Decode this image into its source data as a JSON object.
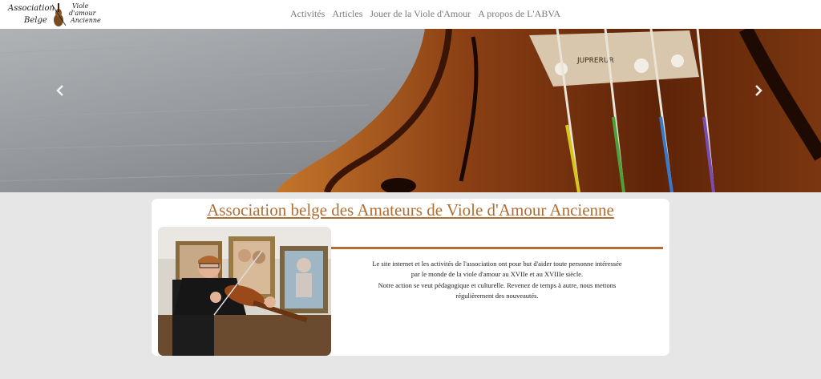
{
  "logo": {
    "line1": "Association",
    "line2": "Belge",
    "line3a": "Viole",
    "line3b": "d'amour",
    "line3c": "Ancienne"
  },
  "nav": {
    "items": [
      "Activités",
      "Articles",
      "Jouer de la Viole d'Amour",
      "A propos de L'ABVA"
    ]
  },
  "hero": {
    "prev_icon": "chevron-left-icon",
    "next_icon": "chevron-right-icon"
  },
  "main": {
    "title": "Association belge des Amateurs de Viole d'Amour Ancienne",
    "lines": [
      "Le site internet et les activités de l'association ont pour but d'aider toute personne intéressée",
      "par le monde de la viole d'amour au XVIIe et au XVIIIe siècle.",
      "Notre action se veut pédagogique et culturelle. Revenez de temps à autre, nous mettons",
      "régulièrement des nouveautés."
    ]
  },
  "colors": {
    "accent": "#b06d32",
    "background": "#e6e6e6"
  }
}
